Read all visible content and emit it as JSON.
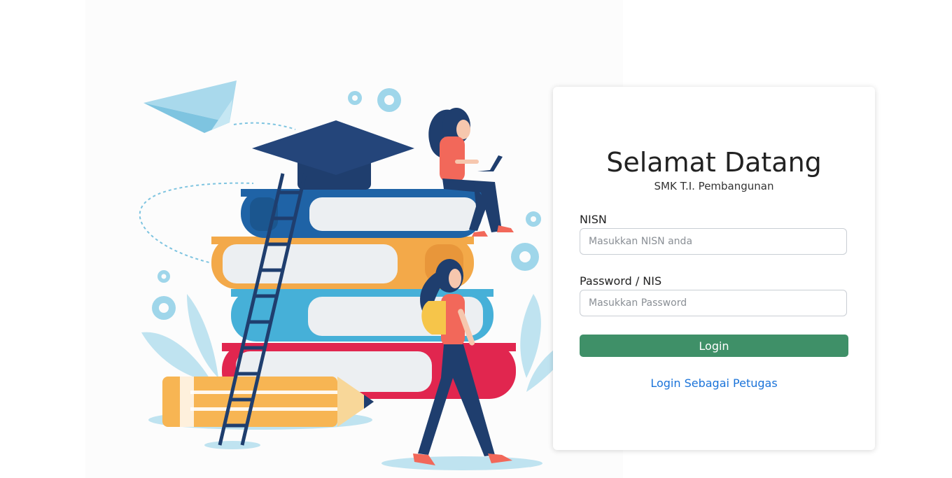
{
  "hero": {
    "illustration_name": "students-with-books-illustration",
    "colors": {
      "navy": "#1f3e6e",
      "blue": "#1f63a6",
      "orange": "#f3a949",
      "light_blue": "#46b0d8",
      "crimson": "#e1264f",
      "pale_blue": "#bfe3f0",
      "skin": "#f6c7ae",
      "shirt": "#f2685a"
    }
  },
  "login_card": {
    "title": "Selamat Datang",
    "subtitle": "SMK T.I. Pembangunan",
    "nisn_label": "NISN",
    "nisn_placeholder": "Masukkan NISN anda",
    "nisn_value": "",
    "password_label": "Password / NIS",
    "password_placeholder": "Masukkan Password",
    "password_value": "",
    "login_button": "Login",
    "staff_login_link": "Login Sebagai Petugas",
    "colors": {
      "button": "#3f9068",
      "link": "#1a73d9"
    }
  }
}
